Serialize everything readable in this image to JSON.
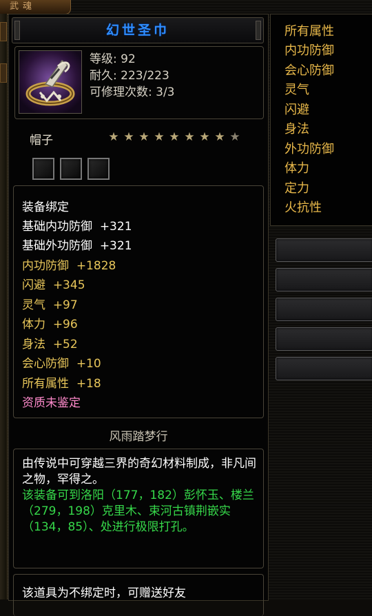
{
  "top_tab": {
    "label": "武魂"
  },
  "item": {
    "name": "幻世圣巾",
    "level_label": "等级:",
    "level_value": "92",
    "durability_label": "耐久:",
    "durability_value": "223/223",
    "repair_label": "可修理次数:",
    "repair_value": "3/3",
    "icon": "headband-icon",
    "slot_type": "帽子",
    "stars_total": 9,
    "stars_lit": 9,
    "gem_slots": 3
  },
  "attributes": {
    "bind_status": "装备绑定",
    "base": [
      {
        "name": "基础内功防御",
        "value": "+321"
      },
      {
        "name": "基础外功防御",
        "value": "+321"
      }
    ],
    "extra": [
      {
        "name": "内功防御",
        "value": "+1828"
      },
      {
        "name": "闪避",
        "value": "+345"
      },
      {
        "name": "灵气",
        "value": "+97"
      },
      {
        "name": "体力",
        "value": "+96"
      },
      {
        "name": "身法",
        "value": "+52"
      },
      {
        "name": "会心防御",
        "value": "+10"
      },
      {
        "name": "所有属性",
        "value": "+18"
      }
    ],
    "unidentified": "资质未鉴定"
  },
  "set_name": "风雨踏梦行",
  "description": {
    "lore": "由传说中可穿越三界的奇幻材料制成，非凡间之物，罕得之。",
    "hint": "该装备可到洛阳（177，182）彭怀玉、楼兰（279，198）克里木、束河古镇荆嵌实（134，85）、处进行极限打孔。"
  },
  "note": "该道具为不绑定时，可赠送好友",
  "right_list": [
    "所有属性",
    "内功防御",
    "会心防御",
    "灵气",
    "闪避",
    "身法",
    "外功防御",
    "体力",
    "定力",
    "火抗性"
  ],
  "colors": {
    "title": "#2e8dff",
    "extra_attr": "#e8c65a",
    "hint_green": "#36d84a",
    "unidentified_pink": "#ff8acb",
    "right_list": "#e8b84a"
  }
}
